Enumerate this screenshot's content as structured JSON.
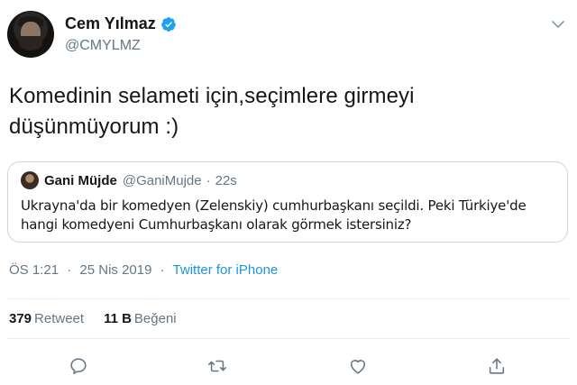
{
  "author": {
    "display_name": "Cem Yılmaz",
    "handle": "@CMYLMZ",
    "verified": true
  },
  "tweet": {
    "text": "Komedinin selameti için,seçimlere girmeyi düşünmüyorum :)",
    "time": "ÖS 1:21",
    "date": "25 Nis 2019",
    "source": "Twitter for iPhone",
    "separator": "·"
  },
  "quoted": {
    "display_name": "Gani Müjde",
    "handle": "@GaniMujde",
    "separator": "·",
    "time": "22s",
    "text": "Ukrayna'da bir komedyen (Zelenskiy) cumhurbaşkanı seçildi. Peki Türkiye'de hangi komedyeni Cumhurbaşkanı olarak görmek istersiniz?"
  },
  "stats": {
    "retweets_count": "379",
    "retweets_label": "Retweet",
    "likes_count": "11 B",
    "likes_label": "Beğeni"
  },
  "actions": {
    "icons": [
      "reply-icon",
      "retweet-icon",
      "like-icon",
      "share-icon"
    ]
  },
  "colors": {
    "accent": "#1b95e0",
    "muted": "#657786",
    "text": "#14171a",
    "border": "#ccd6dd"
  }
}
